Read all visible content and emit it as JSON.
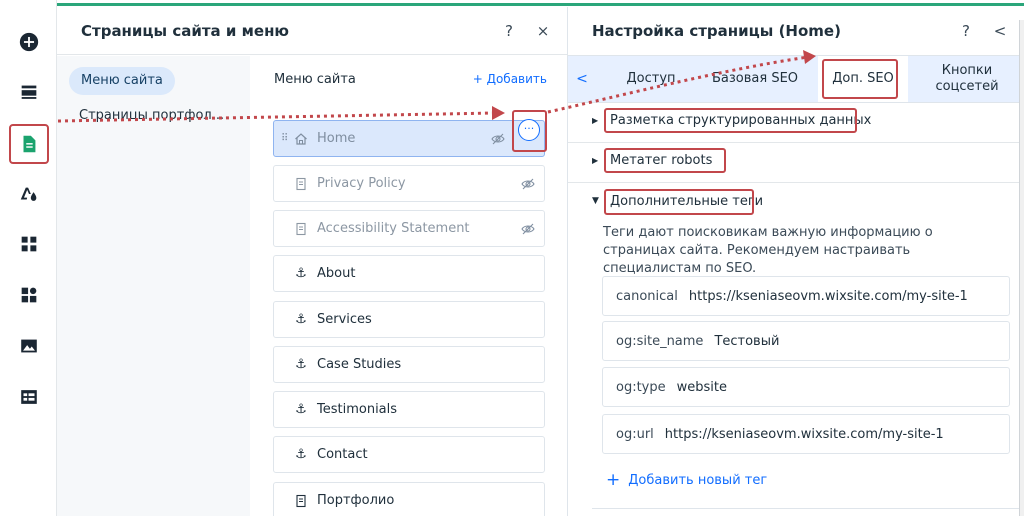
{
  "colors": {
    "accent": "#116dff",
    "annotation": "#c2474b",
    "brand_strip": "#2aa67a"
  },
  "rail": {
    "items": [
      {
        "icon": "add-icon"
      },
      {
        "icon": "menu-icon"
      },
      {
        "icon": "pages-icon",
        "active": true
      },
      {
        "icon": "design-icon"
      },
      {
        "icon": "apps-grid-icon"
      },
      {
        "icon": "puzzle-icon"
      },
      {
        "icon": "media-icon"
      },
      {
        "icon": "table-icon"
      }
    ]
  },
  "pages_panel": {
    "title": "Страницы сайта и меню",
    "help": "?",
    "close": "×",
    "left_nav": {
      "active_item": "Меню сайта",
      "second_item": "Страницы портфол..."
    },
    "menu": {
      "header": "Меню сайта",
      "add_label": "+ Добавить",
      "pages": [
        {
          "label": "Home",
          "icon": "home-icon",
          "hidden": true,
          "selected": true
        },
        {
          "label": "Privacy Policy",
          "icon": "page-icon",
          "hidden": true
        },
        {
          "label": "Accessibility Statement",
          "icon": "page-icon",
          "hidden": true
        },
        {
          "label": "About",
          "icon": "anchor-icon"
        },
        {
          "label": "Services",
          "icon": "anchor-icon"
        },
        {
          "label": "Case Studies",
          "icon": "anchor-icon"
        },
        {
          "label": "Testimonials",
          "icon": "anchor-icon"
        },
        {
          "label": "Contact",
          "icon": "anchor-icon"
        },
        {
          "label": "Портфолио",
          "icon": "page-icon"
        }
      ],
      "more_button": "···"
    }
  },
  "seo_panel": {
    "title": "Настройка страницы (Home)",
    "help": "?",
    "back": "<",
    "tabs": {
      "back_arrow": "<",
      "items": [
        "Доступ",
        "Базовая SEO",
        "Доп. SEO",
        "Кнопки соцсетей"
      ],
      "active": "Доп. SEO"
    },
    "sections": {
      "structured_data": "Разметка структурированных данных",
      "robots": "Метатег robots",
      "additional_tags": "Дополнительные теги"
    },
    "description": "Теги дают поисковикам важную информацию о страницах сайта. Рекомендуем настраивать специалистам по SEO.",
    "tags": [
      {
        "key": "canonical",
        "value": "https://kseniaseovm.wixsite.com/my-site-1"
      },
      {
        "key": "og:site_name",
        "value": "Тестовый"
      },
      {
        "key": "og:type",
        "value": "website"
      },
      {
        "key": "og:url",
        "value": "https://kseniaseovm.wixsite.com/my-site-1"
      }
    ],
    "add_tag_label": "Добавить новый тег"
  }
}
